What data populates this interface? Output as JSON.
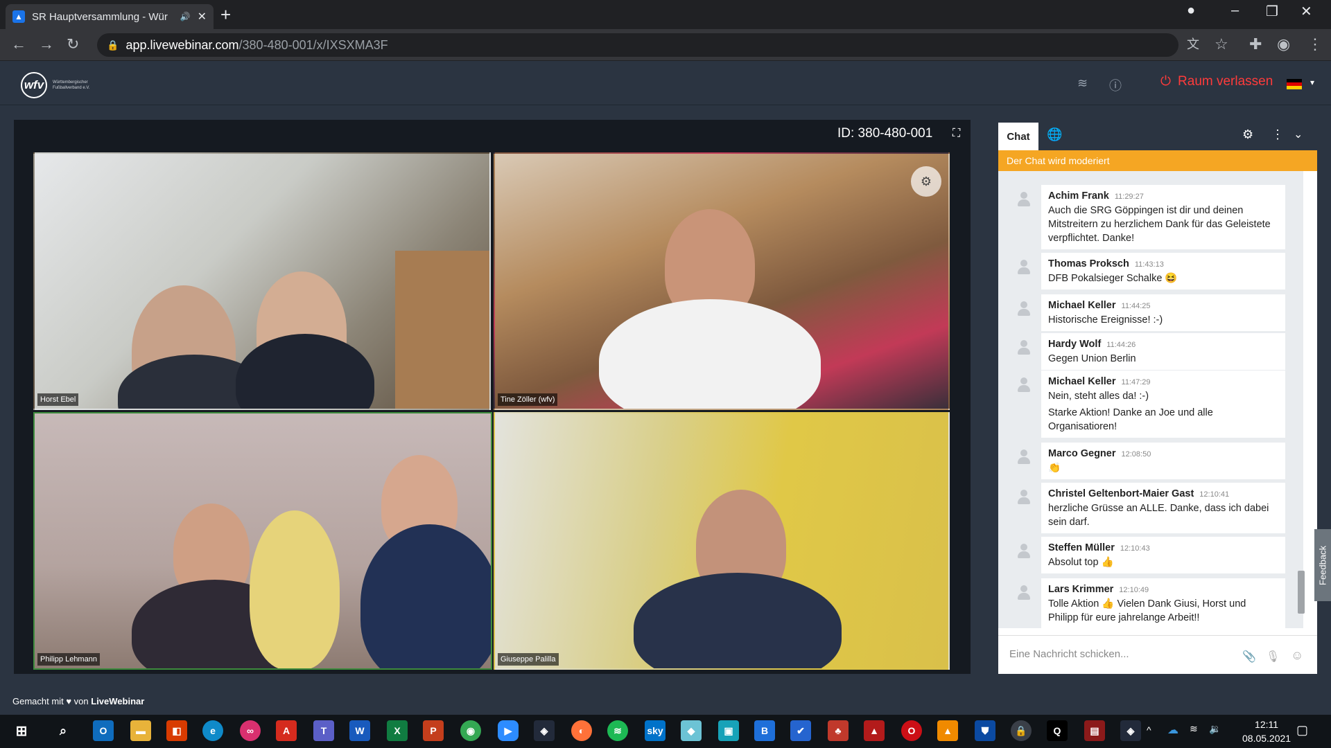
{
  "browser": {
    "tab_title": "SR Hauptversammlung - Wür",
    "url_host": "app.livewebinar.com",
    "url_path": "/380-480-001/x/IXSXMA3F"
  },
  "app": {
    "logo_text": "wfv",
    "logo_sub": "Württembergischer Fußballverband e.V.",
    "leave_label": "Raum verlassen",
    "room_id": "ID: 380-480-001",
    "footer_prefix": "Gemacht mit",
    "footer_suffix": "von",
    "footer_brand": "LiveWebinar"
  },
  "video_tiles": [
    {
      "name": "Horst Ebel"
    },
    {
      "name": "Tine Zöller (wfv)"
    },
    {
      "name": "Philipp Lehmann"
    },
    {
      "name": "Giuseppe Palilla"
    }
  ],
  "chat": {
    "tab_label": "Chat",
    "moderated_notice": "Der Chat wird moderiert",
    "input_placeholder": "Eine Nachricht schicken...",
    "feedback_label": "Feedback",
    "messages": [
      {
        "author": "Achim Frank",
        "time": "11:29:27",
        "text": "Auch die SRG Göppingen ist dir und deinen Mitstreitern zu herzlichem Dank für das Geleistete verpflichtet. Danke!"
      },
      {
        "author": "Thomas Proksch",
        "time": "11:43:13",
        "text": "DFB Pokalsieger Schalke 😆"
      },
      {
        "author": "Michael Keller",
        "time": "11:44:25",
        "text": "Historische Ereignisse! :-)"
      },
      {
        "author": "Hardy Wolf",
        "time": "11:44:26",
        "text": "Gegen Union Berlin"
      },
      {
        "author": "Michael Keller",
        "time": "11:47:29",
        "text": "Nein, steht alles da! :-)",
        "text2": "Starke Aktion! Danke an Joe und alle Organisatioren!"
      },
      {
        "author": "Marco Gegner",
        "time": "12:08:50",
        "text": "👏"
      },
      {
        "author": "Christel Geltenbort-Maier Gast",
        "time": "12:10:41",
        "text": "herzliche Grüsse an ALLE. Danke, dass ich dabei sein darf."
      },
      {
        "author": "Steffen Müller",
        "time": "12:10:43",
        "text": "Absolut top 👍"
      },
      {
        "author": "Lars Krimmer",
        "time": "12:10:49",
        "text": "Tolle Aktion 👍 Vielen Dank Giusi, Horst und Philipp für eure jahrelange Arbeit!!"
      }
    ]
  },
  "taskbar": {
    "time": "12:11",
    "date": "08.05.2021"
  },
  "colors": {
    "accent": "#f5a623",
    "leave": "#ff3b3b",
    "bg": "#2b3441"
  }
}
